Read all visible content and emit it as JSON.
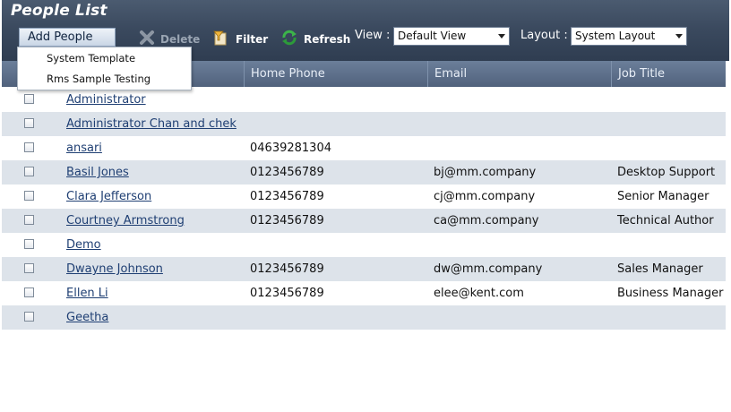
{
  "page": {
    "title": "People List"
  },
  "toolbar": {
    "add_label": "Add People",
    "delete_label": "Delete",
    "filter_label": "Filter",
    "refresh_label": "Refresh",
    "view_label": "View :",
    "view_value": "Default View",
    "layout_label": "Layout :",
    "layout_value": "System Layout"
  },
  "add_menu": {
    "items": [
      "System Template",
      "Rms Sample Testing"
    ]
  },
  "columns": [
    "",
    "Home Phone",
    "Email",
    "Job Title"
  ],
  "rows": [
    {
      "name": "Administrator",
      "phone": "",
      "email": "",
      "job": ""
    },
    {
      "name": "Administrator Chan and chek",
      "phone": "",
      "email": "",
      "job": ""
    },
    {
      "name": "ansari",
      "phone": "04639281304",
      "email": "",
      "job": ""
    },
    {
      "name": "Basil Jones",
      "phone": "0123456789",
      "email": "bj@mm.company",
      "job": "Desktop Support"
    },
    {
      "name": "Clara Jefferson",
      "phone": "0123456789",
      "email": "cj@mm.company",
      "job": "Senior Manager"
    },
    {
      "name": "Courtney Armstrong",
      "phone": "0123456789",
      "email": "ca@mm.company",
      "job": "Technical Author"
    },
    {
      "name": "Demo",
      "phone": "",
      "email": "",
      "job": ""
    },
    {
      "name": "Dwayne Johnson",
      "phone": "0123456789",
      "email": "dw@mm.company",
      "job": "Sales Manager"
    },
    {
      "name": "Ellen Li",
      "phone": "0123456789",
      "email": "elee@kent.com",
      "job": "Business Manager"
    },
    {
      "name": "Geetha",
      "phone": "",
      "email": "",
      "job": ""
    }
  ]
}
